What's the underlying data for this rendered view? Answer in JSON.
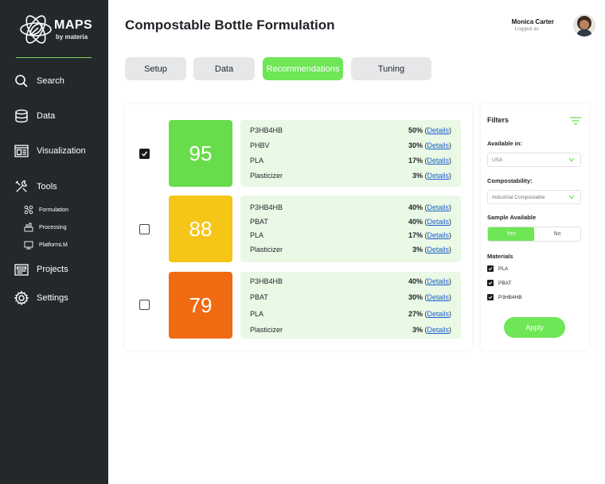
{
  "brand": {
    "name": "MAPS",
    "sub": "by materia",
    "accent": "#6ee656"
  },
  "sidebar": {
    "items": [
      {
        "label": "Search",
        "icon": "search-icon"
      },
      {
        "label": "Data",
        "icon": "database-icon"
      },
      {
        "label": "Visualization",
        "icon": "visualization-icon"
      },
      {
        "label": "Tools",
        "icon": "tools-icon"
      },
      {
        "label": "Projects",
        "icon": "projects-icon"
      },
      {
        "label": "Settings",
        "icon": "gear-icon"
      }
    ],
    "subitems": [
      {
        "label": "Formulation",
        "icon": "formulation-icon"
      },
      {
        "label": "Processing",
        "icon": "processing-icon"
      },
      {
        "label": "PlatformLM",
        "icon": "platformlm-icon"
      }
    ]
  },
  "header": {
    "title": "Compostable Bottle Formulation",
    "user_name": "Monica Carter",
    "user_status": "Logged as"
  },
  "tabs": [
    {
      "label": "Setup",
      "active": false
    },
    {
      "label": "Data",
      "active": false
    },
    {
      "label": "Recommendations",
      "active": true
    },
    {
      "label": "Tuning",
      "active": false
    }
  ],
  "results": [
    {
      "score": "95",
      "checked": true,
      "color": "#69dc4b",
      "materials": [
        {
          "name": "P3HB4HB",
          "pct": "50%",
          "link": "Details"
        },
        {
          "name": "PHBV",
          "pct": "30%",
          "link": "Details"
        },
        {
          "name": "PLA",
          "pct": "17%",
          "link": "Details"
        },
        {
          "name": "Plasticizer",
          "pct": "3%",
          "link": "Details"
        }
      ]
    },
    {
      "score": "88",
      "checked": false,
      "color": "#f5c518",
      "materials": [
        {
          "name": "P3HB4HB",
          "pct": "40%",
          "link": "Details"
        },
        {
          "name": "PBAT",
          "pct": "40%",
          "link": "Details"
        },
        {
          "name": "PLA",
          "pct": "17%",
          "link": "Details"
        },
        {
          "name": "Plasticizer",
          "pct": "3%",
          "link": "Details"
        }
      ]
    },
    {
      "score": "79",
      "checked": false,
      "color": "#f06a12",
      "materials": [
        {
          "name": "P3HB4HB",
          "pct": "40%",
          "link": "Details"
        },
        {
          "name": "PBAT",
          "pct": "30%",
          "link": "Details"
        },
        {
          "name": "PLA",
          "pct": "27%",
          "link": "Details"
        },
        {
          "name": "Plasticizer",
          "pct": "3%",
          "link": "Details"
        }
      ]
    }
  ],
  "filters": {
    "title": "Filters",
    "available_label": "Available in:",
    "available_value": "USA",
    "compost_label": "Compostability:",
    "compost_value": "Industrial Compostable",
    "sample_label": "Sample Available",
    "sample_yes": "Yes",
    "sample_no": "No",
    "sample_selected": "Yes",
    "materials_label": "Materials",
    "materials": [
      {
        "name": "PLA",
        "checked": true
      },
      {
        "name": "PBAT",
        "checked": true
      },
      {
        "name": "P3HB4HB",
        "checked": true
      }
    ],
    "apply_label": "Apply"
  }
}
